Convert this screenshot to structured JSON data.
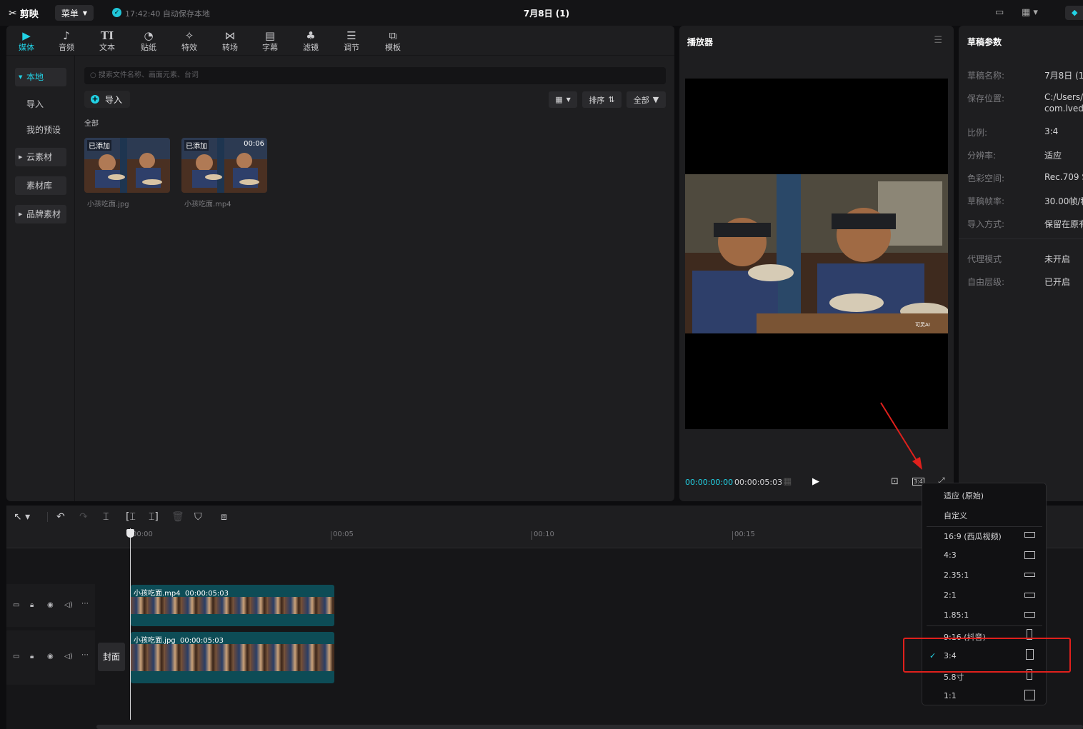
{
  "app": {
    "logo": "剪映",
    "menu_label": "菜单",
    "autosave_text": "17:42:40 自动保存本地",
    "project_title": "7月8日 (1)"
  },
  "media_tabs": [
    {
      "label": "媒体",
      "icon": "media-icon"
    },
    {
      "label": "音频",
      "icon": "audio-icon"
    },
    {
      "label": "文本",
      "icon": "text-icon"
    },
    {
      "label": "贴纸",
      "icon": "sticker-icon"
    },
    {
      "label": "特效",
      "icon": "effects-icon"
    },
    {
      "label": "转场",
      "icon": "transition-icon"
    },
    {
      "label": "字幕",
      "icon": "subtitle-icon"
    },
    {
      "label": "滤镜",
      "icon": "filter-icon"
    },
    {
      "label": "调节",
      "icon": "adjust-icon"
    },
    {
      "label": "模板",
      "icon": "template-icon"
    }
  ],
  "sidebar": {
    "items": [
      "本地",
      "导入",
      "我的预设",
      "云素材",
      "素材库",
      "品牌素材"
    ]
  },
  "media": {
    "search_placeholder": "搜索文件名称、画面元素、台词",
    "import_label": "导入",
    "sort_label": "排序",
    "filter_label": "全部",
    "section_label": "全部",
    "items": [
      {
        "tag": "已添加",
        "duration": "",
        "name": "小孩吃面.jpg"
      },
      {
        "tag": "已添加",
        "duration": "00:06",
        "name": "小孩吃面.mp4"
      }
    ]
  },
  "player": {
    "title": "播放器",
    "current_time": "00:00:00:00",
    "total_time": "00:00:05:03",
    "ratio_button": "3:4",
    "watermark": "可灵AI"
  },
  "draft": {
    "title": "草稿参数",
    "rows": [
      {
        "label": "草稿名称:",
        "value": "7月8日 (1"
      },
      {
        "label": "保存位置:",
        "value": "C:/Users/"
      },
      {
        "label": "",
        "value": "com.lvedi"
      },
      {
        "label": "比例:",
        "value": "3:4"
      },
      {
        "label": "分辨率:",
        "value": "适应"
      },
      {
        "label": "色彩空间:",
        "value": "Rec.709 S"
      },
      {
        "label": "草稿帧率:",
        "value": "30.00帧/秒"
      },
      {
        "label": "导入方式:",
        "value": "保留在原有"
      },
      {
        "label": "代理模式",
        "value": "未开启"
      },
      {
        "label": "自由层级:",
        "value": "已开启"
      }
    ]
  },
  "timeline": {
    "ticks": [
      "00:00",
      "00:05",
      "00:10",
      "00:15"
    ],
    "cover_label": "封面",
    "clips": [
      {
        "name": "小孩吃面.mp4",
        "duration": "00:00:05:03"
      },
      {
        "name": "小孩吃面.jpg",
        "duration": "00:00:05:03"
      }
    ]
  },
  "ratio_menu": {
    "items": [
      "适应 (原始)",
      "自定义",
      "16:9 (西瓜视频)",
      "4:3",
      "2.35:1",
      "2:1",
      "1.85:1",
      "9:16 (抖音)",
      "3:4",
      "5.8寸",
      "1:1"
    ],
    "selected": "3:4"
  },
  "colors": {
    "accent": "#22d3e6",
    "highlight": "#e0201c",
    "clip": "#0d4c56"
  }
}
